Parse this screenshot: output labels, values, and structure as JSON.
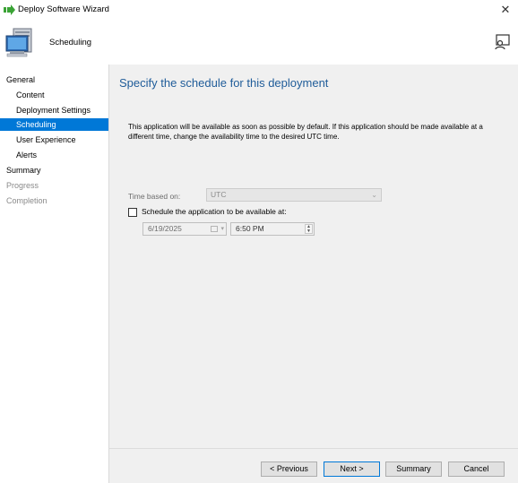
{
  "window": {
    "title": "Deploy Software Wizard",
    "close_glyph": "✕"
  },
  "header": {
    "title": "Scheduling"
  },
  "nav": {
    "items": [
      {
        "label": "General",
        "level": "top",
        "state": "normal"
      },
      {
        "label": "Content",
        "level": "sub",
        "state": "normal"
      },
      {
        "label": "Deployment Settings",
        "level": "sub",
        "state": "normal"
      },
      {
        "label": "Scheduling",
        "level": "sub",
        "state": "selected"
      },
      {
        "label": "User Experience",
        "level": "sub",
        "state": "normal"
      },
      {
        "label": "Alerts",
        "level": "sub",
        "state": "normal"
      },
      {
        "label": "Summary",
        "level": "top",
        "state": "normal"
      },
      {
        "label": "Progress",
        "level": "top",
        "state": "disabled"
      },
      {
        "label": "Completion",
        "level": "top",
        "state": "disabled"
      }
    ]
  },
  "main": {
    "heading": "Specify the schedule for this deployment",
    "description": "This application will be available as soon as possible by default. If this application should be made available at a different time, change the availability time to the desired UTC time.",
    "time_based_on_label": "Time based on:",
    "time_based_on_value": "UTC",
    "schedule_checkbox_label": "Schedule the application to be available at:",
    "schedule_checked": false,
    "date_value": "6/19/2025",
    "time_value": "6:50 PM"
  },
  "footer": {
    "previous_label": "< Previous",
    "next_label": "Next >",
    "summary_label": "Summary",
    "cancel_label": "Cancel"
  },
  "colors": {
    "accent": "#0078d7",
    "heading": "#1f5c99",
    "panel": "#f0f0f0"
  }
}
